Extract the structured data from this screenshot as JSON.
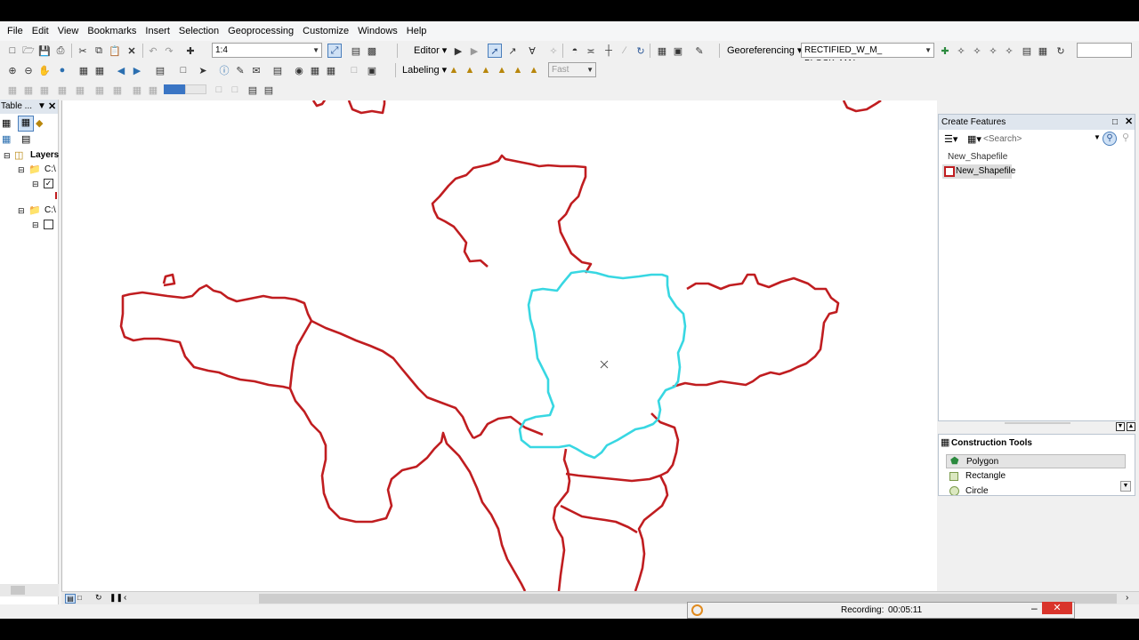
{
  "menu": [
    "File",
    "Edit",
    "View",
    "Bookmarks",
    "Insert",
    "Selection",
    "Geoprocessing",
    "Customize",
    "Windows",
    "Help"
  ],
  "toolbar1": {
    "scale": "1:4",
    "editor": "Editor ▾",
    "georeferencing": "Georeferencing ▾",
    "layer_combo": "RECTIFIED_W_M_ BLOCK_MAI",
    "blank_combo": ""
  },
  "toolbar2": {
    "labeling": "Labeling ▾",
    "quality": "Fast"
  },
  "toc": {
    "title": "Table ...",
    "root": "Layers",
    "items": [
      "C:\\",
      "C:\\"
    ]
  },
  "create_features": {
    "title": "Create Features",
    "search_placeholder": "<Search>",
    "group": "New_Shapefile",
    "template": "New_Shapefile"
  },
  "construction_tools": {
    "title": "Construction Tools",
    "items": [
      "Polygon",
      "Rectangle",
      "Circle"
    ]
  },
  "recording": {
    "label": "Recording:",
    "time": "00:05:11"
  },
  "colors": {
    "boundary": "#c01d20",
    "selected": "#38d7e2",
    "panel_header": "#dfe6ee",
    "close_red": "#d9342b"
  }
}
